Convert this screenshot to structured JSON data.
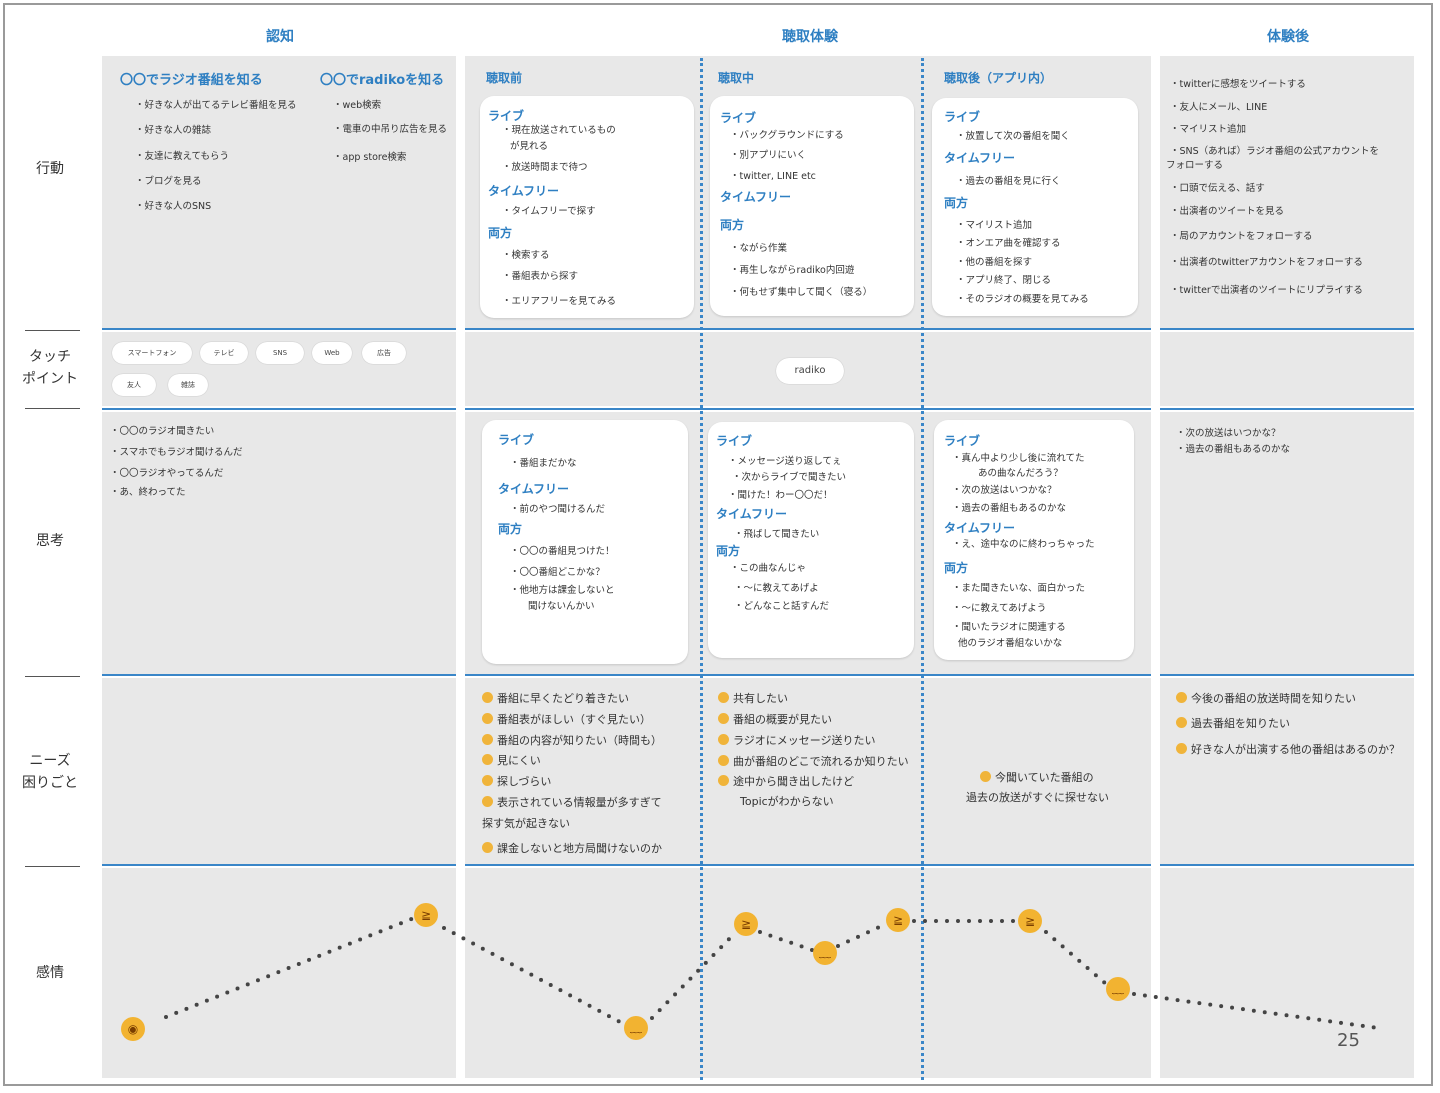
{
  "phases": {
    "ninchi": "認知",
    "choushu": "聴取体験",
    "taikengo": "体験後"
  },
  "rows": {
    "koudou": "行動",
    "touch_1": "タッチ",
    "touch_2": "ポイント",
    "shikou": "思考",
    "needs_1": "ニーズ",
    "needs_2": "困りごと",
    "kanjou": "感情"
  },
  "categories": {
    "live": "ライブ",
    "timefree": "タイムフリー",
    "both": "両方"
  },
  "koudou": {
    "ninchi": {
      "title1": "〇〇でラジオ番組を知る",
      "items1": [
        "・好きな人が出てるテレビ番組を見る",
        "・好きな人の雑誌",
        "・友達に教えてもらう",
        "・ブログを見る",
        "・好きな人のSNS"
      ],
      "title2": "〇〇でradikoを知る",
      "items2": [
        "・web検索",
        "・電車の中吊り広告を見る",
        "・app store検索"
      ]
    },
    "mae": {
      "title": "聴取前",
      "live": [
        "・現在放送されているもの",
        "が見れる",
        "・放送時間まで待つ"
      ],
      "timefree": [
        "・タイムフリーで探す"
      ],
      "both": [
        "・検索する",
        "・番組表から探す",
        "・エリアフリーを見てみる"
      ]
    },
    "naka": {
      "title": "聴取中",
      "live": [
        "・バックグラウンドにする",
        "・別アプリにいく",
        "・twitter, LINE etc"
      ],
      "both": [
        "・ながら作業",
        "・再生しながらradiko内回遊",
        "・何もせず集中して聞く（寝る）"
      ]
    },
    "go": {
      "title": "聴取後（アプリ内）",
      "live": [
        "・放置して次の番組を聞く"
      ],
      "timefree": [
        "・過去の番組を見に行く"
      ],
      "both": [
        "・マイリスト追加",
        "・オンエア曲を確認する",
        "・他の番組を探す",
        "・アプリ終了、閉じる",
        "・そのラジオの概要を見てみる"
      ]
    },
    "taikengo": [
      "・twitterに感想をツイートする",
      "・友人にメール、LINE",
      "・マイリスト追加",
      "・SNS（あれば）ラジオ番組の公式アカウントを",
      "フォローする",
      "・口頭で伝える、話す",
      "・出演者のツイートを見る",
      "・局のアカウントをフォローする",
      "・出演者のtwitterアカウントをフォローする",
      "・twitterで出演者のツイートにリプライする"
    ]
  },
  "touchpoints": {
    "ninchi": [
      "スマートフォン",
      "テレビ",
      "SNS",
      "Web",
      "広告",
      "友人",
      "雑誌"
    ],
    "choushu": "radiko"
  },
  "shikou": {
    "ninchi": [
      "・〇〇のラジオ聞きたい",
      "・スマホでもラジオ聞けるんだ",
      "・〇〇ラジオやってるんだ",
      "・あ、終わってた"
    ],
    "mae": {
      "live": [
        "・番組まだかな"
      ],
      "timefree": [
        "・前のやつ聞けるんだ"
      ],
      "both": [
        "・〇〇の番組見つけた！",
        "・〇〇番組どこかな？",
        "・他地方は課金しないと",
        "聞けないんかい"
      ]
    },
    "naka": {
      "live": [
        "・メッセージ送り返してぇ",
        "・次からライブで聞きたい",
        "・聞けた！わー〇〇だ！"
      ],
      "timefree": [
        "・飛ばして聞きたい"
      ],
      "both": [
        "・この曲なんじゃ",
        "・〜に教えてあげよ",
        "・どんなこと話すんだ"
      ]
    },
    "go": {
      "live": [
        "・真ん中より少し後に流れてた",
        "あの曲なんだろう？",
        "・次の放送はいつかな？",
        "・過去の番組もあるのかな"
      ],
      "timefree": [
        "・え、途中なのに終わっちゃった"
      ],
      "both": [
        "・また聞きたいな、面白かった",
        "・〜に教えてあげよう",
        "・聞いたラジオに関連する",
        "他のラジオ番組ないかな"
      ]
    },
    "taikengo": [
      "・次の放送はいつかな？",
      "・過去の番組もあるのかな"
    ]
  },
  "needs": {
    "mae": [
      "番組に早くたどり着きたい",
      "番組表がほしい（すぐ見たい）",
      "番組の内容が知りたい（時間も）",
      "見にくい",
      "探しづらい",
      "表示されている情報量が多すぎて",
      "探す気が起きない",
      "課金しないと地方局聞けないのか"
    ],
    "naka": [
      "共有したい",
      "番組の概要が見たい",
      "ラジオにメッセージ送りたい",
      "曲が番組のどこで流れるか知りたい",
      "途中から聞き出したけど",
      "Topicがわからない"
    ],
    "go": [
      "今聞いていた番組の",
      "過去の放送がすぐに探せない"
    ],
    "taikengo": [
      "今後の番組の放送時間を知りたい",
      "過去番組を知りたい",
      "好きな人が出演する他の番組はあるのか？"
    ]
  },
  "emotion": {
    "faces": [
      "flushed-face-icon",
      "grinning-squint-face-icon",
      "weary-face-icon",
      "grinning-squint-face-icon",
      "weary-face-icon",
      "grinning-squint-face-icon",
      "grinning-squint-face-icon",
      "weary-face-icon"
    ]
  },
  "page_number": "25",
  "colors": {
    "accent": "#2e7fc2",
    "separator": "#3a86c8",
    "block": "#e8e8e8",
    "emoji": "#f2b331"
  }
}
